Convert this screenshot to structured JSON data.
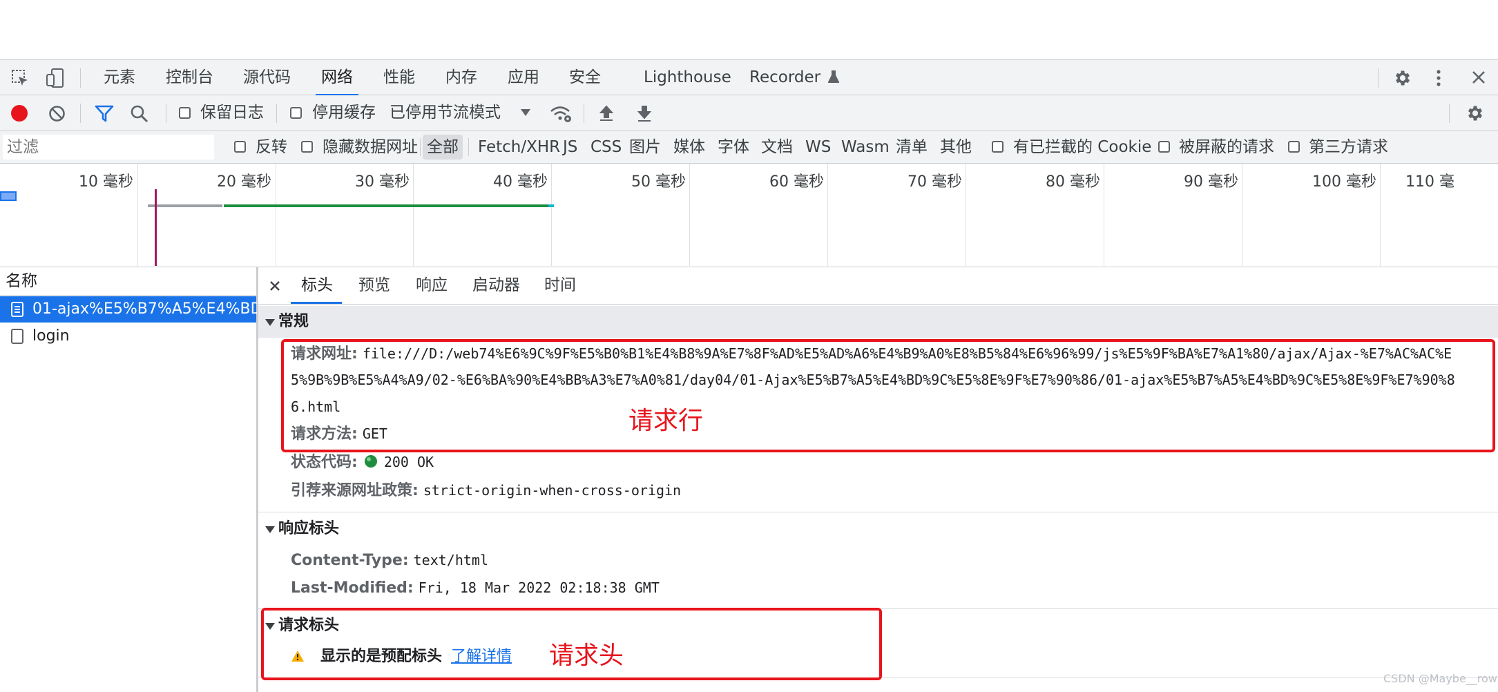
{
  "tabs": [
    "元素",
    "控制台",
    "源代码",
    "网络",
    "性能",
    "内存",
    "应用",
    "安全",
    "Lighthouse",
    "Recorder"
  ],
  "toolbar": {
    "preserve_log": "保留日志",
    "disable_cache": "停用缓存",
    "throttle": "已停用节流模式"
  },
  "filter": {
    "placeholder": "过滤",
    "invert": "反转",
    "hide_data_urls": "隐藏数据网址",
    "types": [
      "全部",
      "Fetch/XHR",
      "JS",
      "CSS",
      "图片",
      "媒体",
      "字体",
      "文档",
      "WS",
      "Wasm",
      "清单",
      "其他"
    ],
    "blocked_cookies": "有已拦截的 Cookie",
    "blocked_requests": "被屏蔽的请求",
    "third_party": "第三方请求"
  },
  "timeline": {
    "ticks": [
      "10 毫秒",
      "20 毫秒",
      "30 毫秒",
      "40 毫秒",
      "50 毫秒",
      "60 毫秒",
      "70 毫秒",
      "80 毫秒",
      "90 毫秒",
      "100 毫秒",
      "110 毫"
    ]
  },
  "list": {
    "header": "名称",
    "items": [
      "01-ajax%E5%B7%A5%E4%BD...",
      "login"
    ]
  },
  "detail_tabs": [
    "标头",
    "预览",
    "响应",
    "启动器",
    "时间"
  ],
  "general": {
    "title": "常规",
    "url_key": "请求网址:",
    "url_lines": [
      "file:///D:/web74%E6%9C%9F%E5%B0%B1%E4%B8%9A%E7%8F%AD%E5%AD%A6%E4%B9%A0%E8%B5%84%E6%96%99/js%E5%9F%BA%E7%A1%80/ajax/Ajax-%E7%AC%AC%E",
      "5%9B%9B%E5%A4%A9/02-%E6%BA%90%E4%BB%A3%E7%A0%81/day04/01-Ajax%E5%B7%A5%E4%BD%9C%E5%8E%9F%E7%90%86/01-ajax%E5%B7%A5%E4%BD%9C%E5%8E%9F%E7%90%8",
      "6.html"
    ],
    "method_key": "请求方法:",
    "method_val": "GET",
    "status_key": "状态代码:",
    "status_val": "200 OK",
    "referrer_key": "引荐来源网址政策:",
    "referrer_val": "strict-origin-when-cross-origin"
  },
  "response_headers": {
    "title": "响应标头",
    "ct_key": "Content-Type:",
    "ct_val": "text/html",
    "lm_key": "Last-Modified:",
    "lm_val": "Fri, 18 Mar 2022 02:18:38 GMT"
  },
  "request_headers": {
    "title": "请求标头",
    "warning": "显示的是预配标头",
    "learn_more": "了解详情"
  },
  "annotations": {
    "request_line": "请求行",
    "request_header": "请求头"
  },
  "watermark": "CSDN @Maybe__row",
  "colors": {
    "accent": "#1a73e8",
    "record": "#e8141c",
    "annotation": "#e8141c",
    "status_ok": "#1e8e3e",
    "selected_row": "#1a73e8"
  }
}
